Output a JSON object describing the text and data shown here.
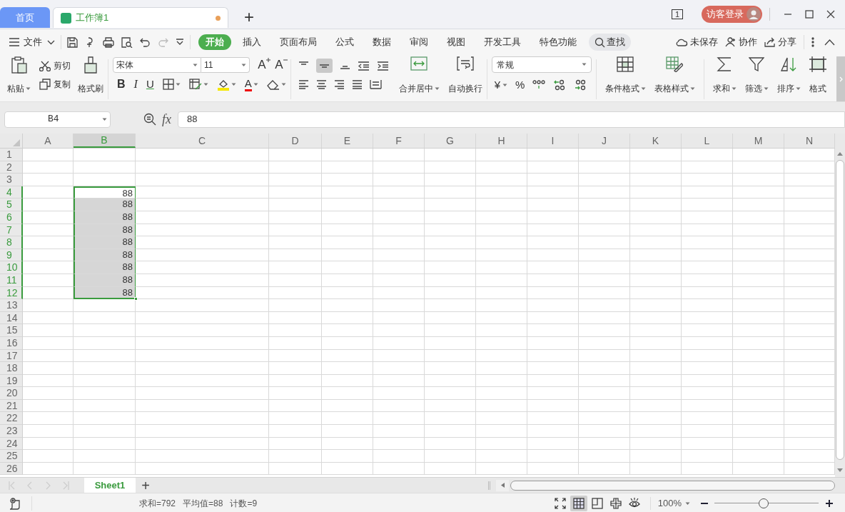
{
  "title_bar": {
    "tabs": [
      {
        "label": "首页",
        "kind": "home",
        "selected": false
      },
      {
        "label": "工作簿1",
        "kind": "document",
        "selected": true,
        "unsaved": true
      }
    ],
    "new_tab": "+",
    "window_count": "1",
    "login_button": "访客登录"
  },
  "menu_bar": {
    "file_menu": "文件",
    "ribbon_tabs": [
      {
        "label": "开始",
        "selected": true
      },
      {
        "label": "插入",
        "selected": false
      },
      {
        "label": "页面布局",
        "selected": false
      },
      {
        "label": "公式",
        "selected": false
      },
      {
        "label": "数据",
        "selected": false
      },
      {
        "label": "审阅",
        "selected": false
      },
      {
        "label": "视图",
        "selected": false
      },
      {
        "label": "开发工具",
        "selected": false
      },
      {
        "label": "特色功能",
        "selected": false
      }
    ],
    "search": "查找",
    "actions": [
      {
        "label": "未保存",
        "kind": "cloud"
      },
      {
        "label": "协作",
        "kind": "person"
      },
      {
        "label": "分享",
        "kind": "share"
      }
    ]
  },
  "ribbon": {
    "paste": "粘贴",
    "cut": "剪切",
    "copy": "复制",
    "format_painter": "格式刷",
    "font_name": "宋体",
    "font_size": "11",
    "grow_font": "A",
    "shrink_font": "A",
    "bold": "B",
    "italic": "I",
    "underline": "U",
    "font_color": "A",
    "merge_center": "合并居中",
    "wrap_text": "自动换行",
    "number_format": "常规",
    "currency": "¥",
    "percent": "%",
    "big_buttons": [
      {
        "label": "条件格式",
        "kind": "conditional"
      },
      {
        "label": "表格样式",
        "kind": "table-style"
      },
      {
        "label": "求和",
        "kind": "sum"
      },
      {
        "label": "筛选",
        "kind": "filter"
      },
      {
        "label": "排序",
        "kind": "sort"
      },
      {
        "label": "格式",
        "kind": "format"
      }
    ]
  },
  "formula_bar": {
    "name_box": "B4",
    "fx": "fx",
    "value": "88"
  },
  "grid": {
    "columns": [
      {
        "label": "A",
        "selected": false
      },
      {
        "label": "B",
        "selected": true
      },
      {
        "label": "C",
        "selected": false
      },
      {
        "label": "D",
        "selected": false
      },
      {
        "label": "E",
        "selected": false
      },
      {
        "label": "F",
        "selected": false
      },
      {
        "label": "G",
        "selected": false
      },
      {
        "label": "H",
        "selected": false
      },
      {
        "label": "I",
        "selected": false
      },
      {
        "label": "J",
        "selected": false
      },
      {
        "label": "K",
        "selected": false
      },
      {
        "label": "L",
        "selected": false
      },
      {
        "label": "M",
        "selected": false
      },
      {
        "label": "N",
        "selected": false
      }
    ],
    "rows": [
      {
        "label": "1",
        "selected": false
      },
      {
        "label": "2",
        "selected": false
      },
      {
        "label": "3",
        "selected": false
      },
      {
        "label": "4",
        "selected": true,
        "active": true,
        "column_b": "88"
      },
      {
        "label": "5",
        "selected": true,
        "active": false,
        "column_b": "88"
      },
      {
        "label": "6",
        "selected": true,
        "active": false,
        "column_b": "88"
      },
      {
        "label": "7",
        "selected": true,
        "active": false,
        "column_b": "88"
      },
      {
        "label": "8",
        "selected": true,
        "active": false,
        "column_b": "88"
      },
      {
        "label": "9",
        "selected": true,
        "active": false,
        "column_b": "88"
      },
      {
        "label": "10",
        "selected": true,
        "active": false,
        "column_b": "88"
      },
      {
        "label": "11",
        "selected": true,
        "active": false,
        "column_b": "88"
      },
      {
        "label": "12",
        "selected": true,
        "active": false,
        "column_b": "88"
      },
      {
        "label": "13",
        "selected": false
      },
      {
        "label": "14",
        "selected": false
      },
      {
        "label": "15",
        "selected": false
      },
      {
        "label": "16",
        "selected": false
      },
      {
        "label": "17",
        "selected": false
      },
      {
        "label": "18",
        "selected": false
      },
      {
        "label": "19",
        "selected": false
      },
      {
        "label": "20",
        "selected": false
      },
      {
        "label": "21",
        "selected": false
      },
      {
        "label": "22",
        "selected": false
      },
      {
        "label": "23",
        "selected": false
      },
      {
        "label": "24",
        "selected": false
      },
      {
        "label": "25",
        "selected": false
      },
      {
        "label": "26",
        "selected": false
      }
    ]
  },
  "sheet_tabs": [
    {
      "label": "Sheet1",
      "selected": true
    }
  ],
  "add_sheet": "+",
  "status_bar": {
    "stats": [
      "求和=792",
      "平均值=88",
      "计数=9"
    ],
    "views": [
      {
        "kind": "fullscreen",
        "selected": false
      },
      {
        "kind": "normal",
        "selected": true
      },
      {
        "kind": "page",
        "selected": false
      },
      {
        "kind": "split",
        "selected": false
      },
      {
        "kind": "eye",
        "selected": false
      }
    ],
    "zoom": "100%",
    "zoom_slider": {
      "level": 0.47
    }
  }
}
